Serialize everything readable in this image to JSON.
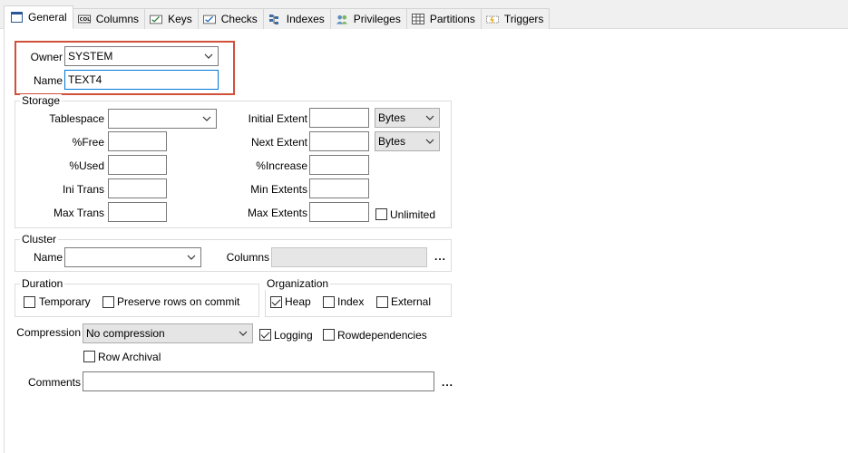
{
  "tabs": [
    {
      "label": "General",
      "icon": "window-icon",
      "active": true
    },
    {
      "label": "Columns",
      "icon": "columns-icon",
      "active": false
    },
    {
      "label": "Keys",
      "icon": "keys-icon",
      "active": false
    },
    {
      "label": "Checks",
      "icon": "checks-icon",
      "active": false
    },
    {
      "label": "Indexes",
      "icon": "indexes-icon",
      "active": false
    },
    {
      "label": "Privileges",
      "icon": "users-icon",
      "active": false
    },
    {
      "label": "Partitions",
      "icon": "grid-icon",
      "active": false
    },
    {
      "label": "Triggers",
      "icon": "triggers-icon",
      "active": false
    }
  ],
  "general": {
    "owner_label": "Owner",
    "owner_value": "SYSTEM",
    "name_label": "Name",
    "name_value": "TEXT4"
  },
  "storage": {
    "title": "Storage",
    "tablespace_label": "Tablespace",
    "tablespace_value": "",
    "free_label": "%Free",
    "used_label": "%Used",
    "ini_trans_label": "Ini Trans",
    "max_trans_label": "Max Trans",
    "initial_extent_label": "Initial Extent",
    "initial_extent_unit": "Bytes",
    "next_extent_label": "Next Extent",
    "next_extent_unit": "Bytes",
    "increase_label": "%Increase",
    "min_extents_label": "Min Extents",
    "max_extents_label": "Max Extents",
    "unlimited_label": "Unlimited",
    "unlimited_checked": false
  },
  "cluster": {
    "title": "Cluster",
    "name_label": "Name",
    "name_value": "",
    "columns_label": "Columns",
    "columns_value": "",
    "ellipsis": "..."
  },
  "duration": {
    "title": "Duration",
    "temporary_label": "Temporary",
    "temporary_checked": false,
    "preserve_label": "Preserve rows on commit",
    "preserve_checked": false
  },
  "organization": {
    "title": "Organization",
    "heap_label": "Heap",
    "heap_checked": true,
    "index_label": "Index",
    "index_checked": false,
    "external_label": "External",
    "external_checked": false
  },
  "compression": {
    "label": "Compression",
    "value": "No compression",
    "logging_label": "Logging",
    "logging_checked": true,
    "rowdep_label": "Rowdependencies",
    "rowdep_checked": false,
    "row_archival_label": "Row Archival",
    "row_archival_checked": false
  },
  "comments": {
    "label": "Comments",
    "value": "",
    "ellipsis": "..."
  },
  "colors": {
    "highlight": "#d0503a",
    "focus": "#0078d7"
  }
}
